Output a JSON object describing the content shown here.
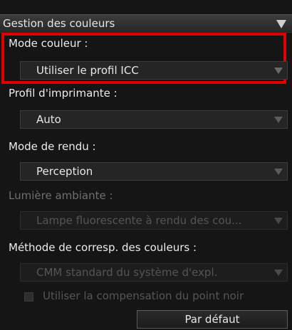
{
  "panel": {
    "title": "Gestion des couleurs",
    "collapse_icon": "triangle-down-icon"
  },
  "color_mode": {
    "label": "Mode couleur :",
    "value": "Utiliser le profil ICC"
  },
  "printer_profile": {
    "label": "Profil d'imprimante :",
    "value": "Auto"
  },
  "rendering_intent": {
    "label": "Mode de rendu :",
    "value": "Perception"
  },
  "ambient_light": {
    "label": "Lumière ambiante :",
    "value": "Lampe fluorescente à rendu des cou..."
  },
  "color_matching": {
    "label": "Méthode de corresp. des couleurs :",
    "value": "CMM standard du système d'expl."
  },
  "black_point": {
    "label": "Utiliser la compensation du point noir",
    "checked": false
  },
  "default_button": {
    "label": "Par défaut"
  },
  "colors": {
    "highlight": "#e00000",
    "background": "#151515"
  }
}
